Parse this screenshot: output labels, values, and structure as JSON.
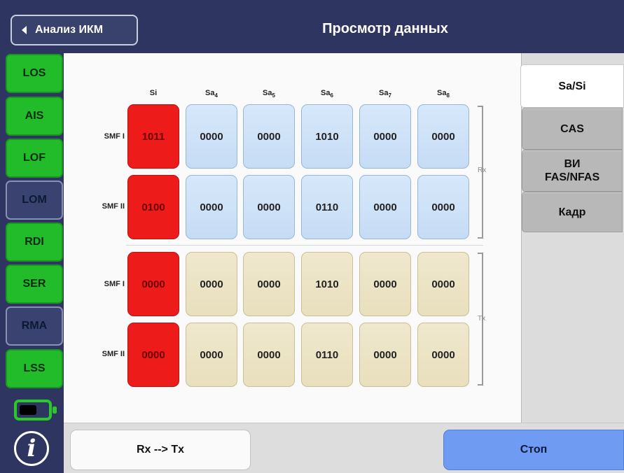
{
  "header": {
    "back_label": "Анализ ИКМ",
    "title": "Просмотр данных"
  },
  "sidebar": {
    "indicators": [
      {
        "label": "LOS",
        "state": "ok",
        "color": "#22bc2a"
      },
      {
        "label": "AIS",
        "state": "ok",
        "color": "#22bc2a"
      },
      {
        "label": "LOF",
        "state": "ok",
        "color": "#22bc2a"
      },
      {
        "label": "LOM",
        "state": "inactive",
        "color": "#3a4270"
      },
      {
        "label": "RDI",
        "state": "ok",
        "color": "#22bc2a"
      },
      {
        "label": "SER",
        "state": "ok",
        "color": "#22bc2a"
      },
      {
        "label": "RMA",
        "state": "inactive",
        "color": "#3a4270"
      },
      {
        "label": "LSS",
        "state": "ok",
        "color": "#22bc2a"
      }
    ],
    "battery_icon": "battery-icon",
    "info_icon": "info-icon",
    "info_glyph": "i"
  },
  "table": {
    "columns": [
      {
        "name": "Si",
        "sub": ""
      },
      {
        "name": "Sa",
        "sub": "4"
      },
      {
        "name": "Sa",
        "sub": "5"
      },
      {
        "name": "Sa",
        "sub": "6"
      },
      {
        "name": "Sa",
        "sub": "7"
      },
      {
        "name": "Sa",
        "sub": "8"
      }
    ],
    "rx_label": "Rx",
    "tx_label": "Tx",
    "rows": [
      {
        "group": "rx",
        "label": "SMF I",
        "values": [
          "1011",
          "0000",
          "0000",
          "1010",
          "0000",
          "0000"
        ]
      },
      {
        "group": "rx",
        "label": "SMF II",
        "values": [
          "0100",
          "0000",
          "0000",
          "0110",
          "0000",
          "0000"
        ]
      },
      {
        "group": "tx",
        "label": "SMF I",
        "values": [
          "0000",
          "0000",
          "0000",
          "1010",
          "0000",
          "0000"
        ]
      },
      {
        "group": "tx",
        "label": "SMF II",
        "values": [
          "0000",
          "0000",
          "0000",
          "0110",
          "0000",
          "0000"
        ]
      }
    ]
  },
  "tabs": [
    {
      "label": "Sa/Si",
      "active": true
    },
    {
      "label": "CAS",
      "active": false
    },
    {
      "label": "ВИ FAS/NFAS",
      "active": false
    },
    {
      "label": "Кадр",
      "active": false
    }
  ],
  "footer": {
    "rxtx_label": "Rx --> Tx",
    "stop_label": "Стоп"
  },
  "colors": {
    "header_bg": "#2e3560",
    "si_cell": "#ee1b1b",
    "rx_cell": "#d6e8fa",
    "tx_cell": "#efe8cd",
    "stop_button": "#6f9cf2",
    "indicator_ok": "#22bc2a"
  }
}
